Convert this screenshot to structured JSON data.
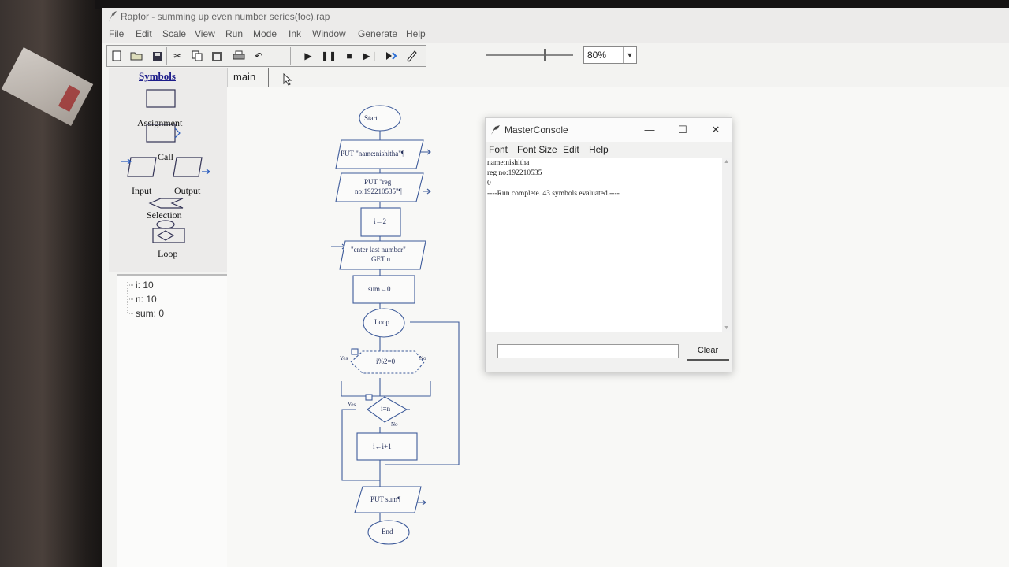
{
  "window": {
    "title": "Raptor - summing up even number series(foc).rap"
  },
  "menu": [
    "File",
    "Edit",
    "Scale",
    "View",
    "Run",
    "Mode",
    "Ink",
    "Window",
    "Generate",
    "Help"
  ],
  "toolbar": {
    "zoom_value": "80%"
  },
  "symbols": {
    "heading": "Symbols",
    "assignment": "Assignment",
    "call": "Call",
    "input": "Input",
    "output": "Output",
    "selection": "Selection",
    "loop": "Loop"
  },
  "watch": [
    {
      "label": "i: 10"
    },
    {
      "label": "n: 10"
    },
    {
      "label": "sum: 0"
    }
  ],
  "editor": {
    "tab": "main"
  },
  "flowchart": {
    "start": "Start",
    "put_name": "PUT \"name:nishitha\"¶",
    "put_reg_1": "PUT \"reg",
    "put_reg_2": "no:192210535\"¶",
    "assign_i": "i←2",
    "input_prompt": "\"enter last number\"",
    "input_get": "GET n",
    "assign_sum": "sum←0",
    "loop": "Loop",
    "cond_even": "i%2=0",
    "yes1": "Yes",
    "no1": "No",
    "cond_exit": "i=n",
    "yes2": "Yes",
    "no2": "No",
    "increment": "i←i+1",
    "put_sum": "PUT sum¶",
    "end": "End"
  },
  "console": {
    "title": "MasterConsole",
    "menu": [
      "Font",
      "Font Size",
      "Edit",
      "Help"
    ],
    "lines": [
      "name:nishitha",
      "reg no:192210535",
      "0",
      "----Run complete.  43 symbols evaluated.----"
    ],
    "clear_label": "Clear"
  }
}
